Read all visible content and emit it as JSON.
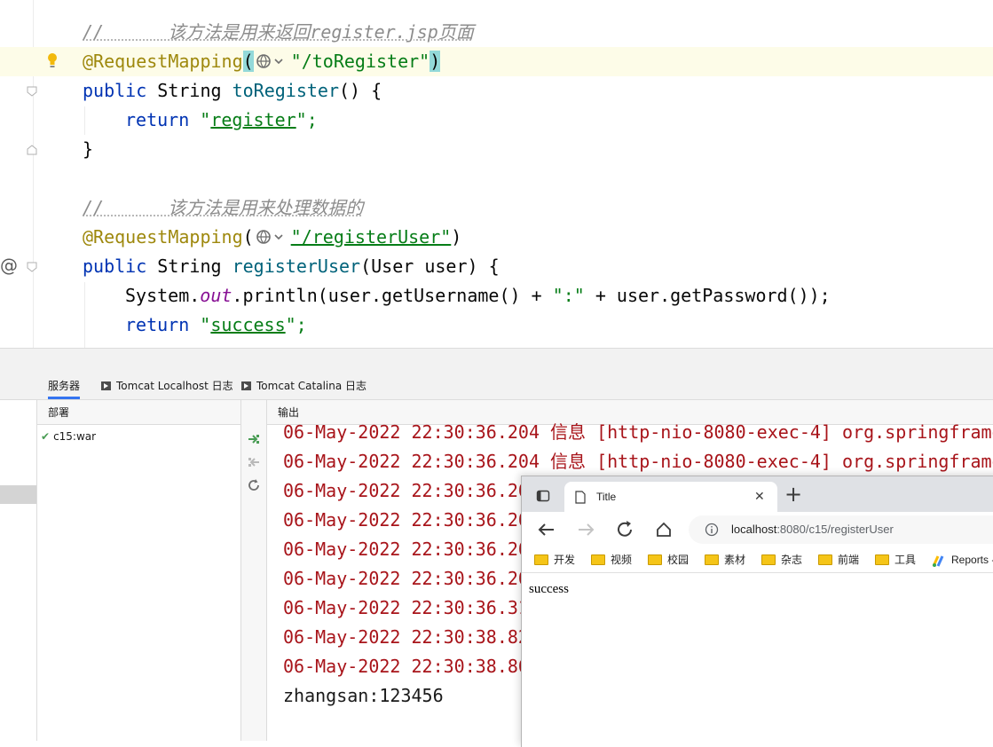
{
  "editor": {
    "comment1_slashes": "//",
    "comment1_text": "该方法是用来返回register.jsp页面",
    "ann1_name": "@RequestMapping",
    "ann1_open": "(",
    "ann1_value": "\"/toRegister\"",
    "ann1_close": ")",
    "m1_kw": "public",
    "m1_type": " String ",
    "m1_name": "toRegister",
    "m1_rest": "() {",
    "ret1_kw": "return",
    "ret1_q1": "\"",
    "ret1_val": "register",
    "ret1_q2": "\";",
    "close1": "}",
    "comment2_slashes": "//",
    "comment2_text": "该方法是用来处理数据的",
    "ann2_name": "@RequestMapping",
    "ann2_open": "(",
    "ann2_value": "\"/registerUser\"",
    "ann2_close": ")",
    "m2_kw": "public",
    "m2_type": " String ",
    "m2_name": "registerUser",
    "m2_rest": "(User user) {",
    "print_a": "System.",
    "print_field": "out",
    "print_b": ".println(user.getUsername() + ",
    "print_str": "\":\"",
    "print_c": " + user.getPassword());",
    "ret2_kw": "return",
    "ret2_q1": "\"",
    "ret2_val": "success",
    "ret2_q2": "\";",
    "at_marker": "@"
  },
  "panel": {
    "tabs": [
      {
        "label": "服务器"
      },
      {
        "label": "Tomcat Localhost 日志"
      },
      {
        "label": "Tomcat Catalina 日志"
      }
    ],
    "deploy_header": "部署",
    "deploy_item": "c15:war",
    "output_header": "输出",
    "log_lines": [
      "06-May-2022 22:30:36.204 信息 [http-nio-8080-exec-4] org.springframe",
      "06-May-2022 22:30:36.204 信息 [http-nio-8080-exec-4] org.springframe",
      "06-May-2022 22:30:36.20",
      "06-May-2022 22:30:36.20",
      "06-May-2022 22:30:36.20",
      "06-May-2022 22:30:36.20",
      "06-May-2022 22:30:36.31",
      "06-May-2022 22:30:38.82",
      "06-May-2022 22:30:38.86"
    ],
    "result_line": "zhangsan:123456"
  },
  "browser": {
    "tab_title": "Title",
    "url_host": "localhost",
    "url_path": ":8080/c15/registerUser",
    "bookmarks": [
      "开发",
      "视频",
      "校园",
      "素材",
      "杂志",
      "前端",
      "工具",
      "Reports -"
    ],
    "page_text": "success"
  },
  "icons": [
    "lightbulb-icon",
    "globe-icon",
    "fold-icon",
    "check-icon",
    "deploy-icon",
    "undeploy-icon",
    "refresh-icon",
    "back-icon",
    "forward-icon",
    "reload-icon",
    "home-icon",
    "info-icon",
    "folder-icon",
    "close-icon",
    "new-tab-icon",
    "tab-actions-icon",
    "page-icon",
    "analytics-icon"
  ]
}
